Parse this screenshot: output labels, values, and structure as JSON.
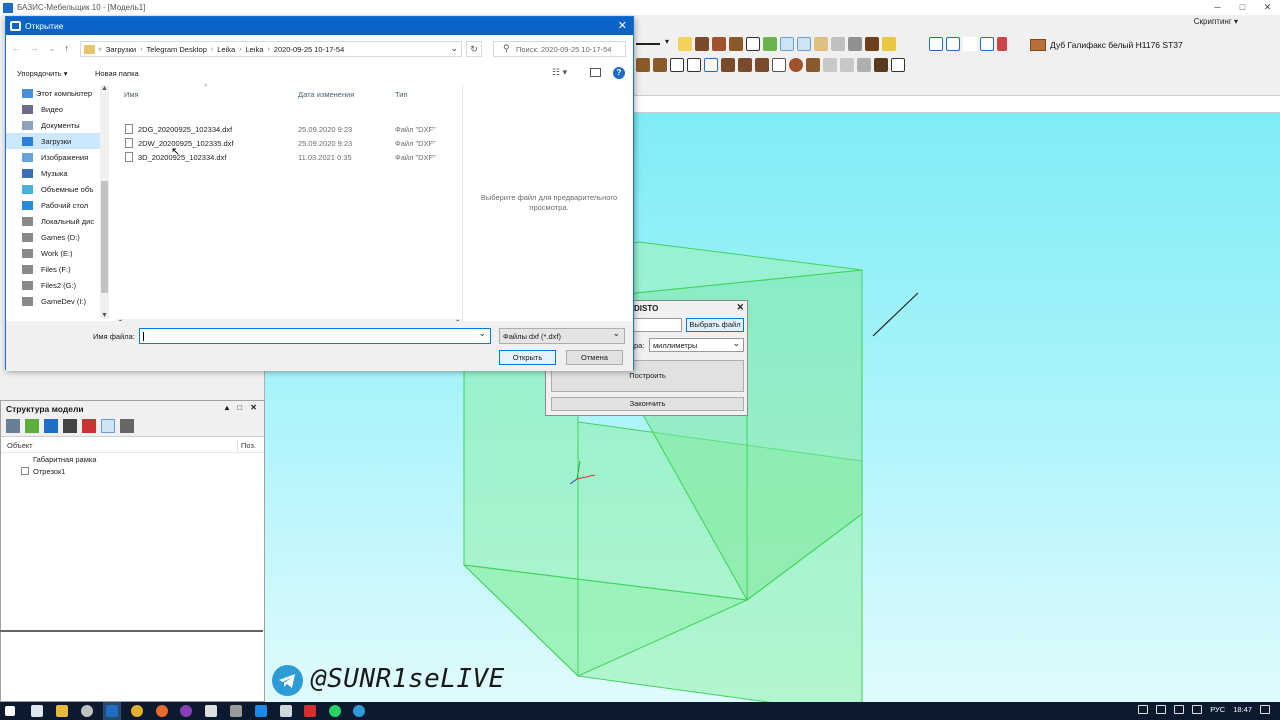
{
  "app": {
    "title": "БАЗИС-Мебельщик 10 - [Модель1]",
    "scripting_label": "Скриптинг",
    "material_name": "Дуб Галифакс белый H1176 ST37"
  },
  "file_dialog": {
    "title": "Открытие",
    "breadcrumb": [
      "Загрузки",
      "Telegram Desktop",
      "Leika",
      "Leika",
      "2020-09-25 10-17-54"
    ],
    "search_placeholder": "Поиск: 2020-09-25 10-17-54",
    "organize_label": "Упорядочить",
    "new_folder_label": "Новая папка",
    "sidebar": [
      {
        "label": "Этот компьютер",
        "icon": "computer-icon"
      },
      {
        "label": "Видео",
        "icon": "video-folder-icon"
      },
      {
        "label": "Документы",
        "icon": "documents-folder-icon"
      },
      {
        "label": "Загрузки",
        "icon": "downloads-folder-icon"
      },
      {
        "label": "Изображения",
        "icon": "pictures-folder-icon"
      },
      {
        "label": "Музыка",
        "icon": "music-folder-icon"
      },
      {
        "label": "Объемные объ",
        "icon": "3d-objects-folder-icon"
      },
      {
        "label": "Рабочий стол",
        "icon": "desktop-folder-icon"
      },
      {
        "label": "Локальный дис",
        "icon": "drive-icon"
      },
      {
        "label": "Games (D:)",
        "icon": "drive-icon"
      },
      {
        "label": "Work (E:)",
        "icon": "drive-icon"
      },
      {
        "label": "Files (F:)",
        "icon": "drive-icon"
      },
      {
        "label": "Files2 (G:)",
        "icon": "drive-icon"
      },
      {
        "label": "GameDev (I:)",
        "icon": "drive-icon"
      }
    ],
    "selected_sidebar": "Загрузки",
    "columns": {
      "name": "Имя",
      "date": "Дата изменения",
      "type": "Тип"
    },
    "files": [
      {
        "name": "2DG_20200925_102334.dxf",
        "date": "25.09.2020 9:23",
        "type": "Файл \"DXF\""
      },
      {
        "name": "2DW_20200925_102335.dxf",
        "date": "25.09.2020 9:23",
        "type": "Файл \"DXF\""
      },
      {
        "name": "3D_20200925_102334.dxf",
        "date": "11.03.2021 0:35",
        "type": "Файл \"DXF\""
      }
    ],
    "preview_text": "Выберите файл для предварительного просмотра.",
    "filename_label": "Имя файла:",
    "filename_value": "",
    "filetype_value": "Файлы dxf (*.dxf)",
    "open_label": "Открыть",
    "cancel_label": "Отмена"
  },
  "disto_dialog": {
    "title": "DISTO",
    "choose_file_label": "Выбрать файл",
    "units_label_fragment": "ра:",
    "units_value": "миллиметры",
    "build_label": "Построить",
    "finish_label": "Закончить"
  },
  "model_tree": {
    "title": "Структура модели",
    "controls": "▴ □ ✕",
    "col_object": "Объект",
    "col_pos": "Поз.",
    "items": [
      "Габаритная рамка",
      "Отрезок1"
    ]
  },
  "watermark": {
    "handle": "@SUNR1seLIVE"
  },
  "taskbar": {
    "language": "РУС",
    "time": "18:47"
  },
  "colors": {
    "accent": "#0a64c8",
    "viewport_top": "#7fecf7",
    "box_fill": "#8ef0a8",
    "box_edge": "#3fd35a",
    "telegram": "#2e9bd6"
  }
}
